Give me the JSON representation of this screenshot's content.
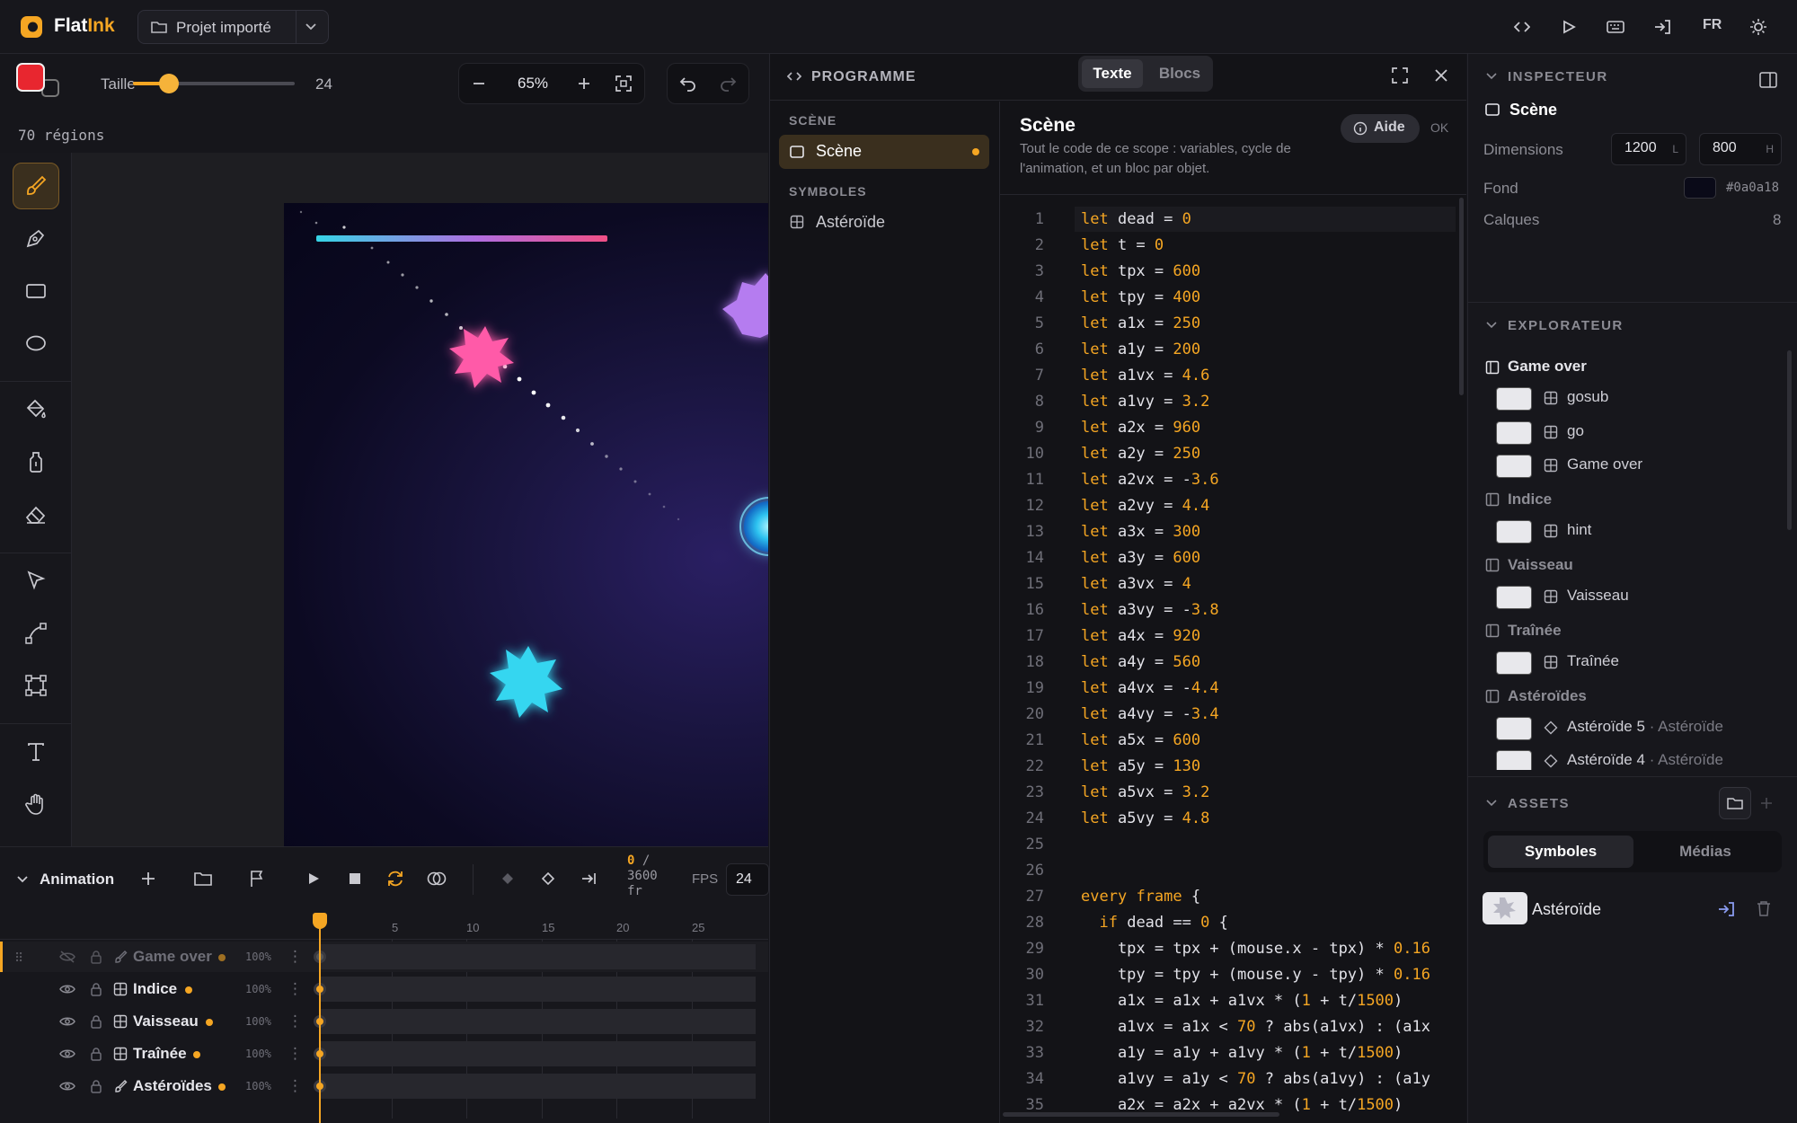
{
  "app": {
    "name_main": "Flat",
    "name_accent": "Ink",
    "project": "Projet importé",
    "language": "FR",
    "accent": "#f5a623"
  },
  "brush": {
    "size_label": "Taille",
    "size_value": "24",
    "color": "#e8262f",
    "size_fraction": 0.22
  },
  "view": {
    "zoom": "65%",
    "regions": "70 régions"
  },
  "tools": [
    "brush-icon",
    "pen-icon",
    "rectangle-icon",
    "ellipse-icon",
    "bucket-icon",
    "dropper-icon",
    "eraser-icon",
    "select-icon",
    "node-icon",
    "transform-icon",
    "text-icon",
    "hand-icon"
  ],
  "timeline": {
    "title": "Animation",
    "frame_current": "0",
    "frame_total": "/ 3600",
    "frame_unit": "fr",
    "fps_label": "FPS",
    "fps_value": "24",
    "ruler": [
      "5",
      "10",
      "15",
      "20",
      "25"
    ],
    "layers": [
      {
        "name": "Game over",
        "opacity": "100%",
        "type": "brush",
        "dim": true
      },
      {
        "name": "Indice",
        "opacity": "100%",
        "type": "symbol"
      },
      {
        "name": "Vaisseau",
        "opacity": "100%",
        "type": "symbol"
      },
      {
        "name": "Traînée",
        "opacity": "100%",
        "type": "symbol"
      },
      {
        "name": "Astéroïdes",
        "opacity": "100%",
        "type": "brush"
      }
    ]
  },
  "program": {
    "title": "PROGRAMME",
    "mode_text": "Texte",
    "mode_blocks": "Blocs",
    "section_scene": "SCÈNE",
    "scene_item": "Scène",
    "section_symbols": "SYMBOLES",
    "symbol_item": "Astéroïde",
    "scope_title": "Scène",
    "scope_desc": "Tout le code de ce scope : variables, cycle de l'animation, et un bloc par objet.",
    "help": "Aide",
    "ok": "OK",
    "code": [
      "let dead = 0",
      "let t = 0",
      "let tpx = 600",
      "let tpy = 400",
      "let a1x = 250",
      "let a1y = 200",
      "let a1vx = 4.6",
      "let a1vy = 3.2",
      "let a2x = 960",
      "let a2y = 250",
      "let a2vx = -3.6",
      "let a2vy = 4.4",
      "let a3x = 300",
      "let a3y = 600",
      "let a3vx = 4",
      "let a3vy = -3.8",
      "let a4x = 920",
      "let a4y = 560",
      "let a4vx = -4.4",
      "let a4vy = -3.4",
      "let a5x = 600",
      "let a5y = 130",
      "let a5vx = 3.2",
      "let a5vy = 4.8",
      "",
      "",
      "every frame {",
      "  if dead == 0 {",
      "    tpx = tpx + (mouse.x - tpx) * 0.16",
      "    tpy = tpy + (mouse.y - tpy) * 0.16",
      "    a1x = a1x + a1vx * (1 + t/1500)",
      "    a1vx = a1x < 70 ? abs(a1vx) : (a1x",
      "    a1y = a1y + a1vy * (1 + t/1500)",
      "    a1vy = a1y < 70 ? abs(a1vy) : (a1y",
      "    a2x = a2x + a2vx * (1 + t/1500)"
    ]
  },
  "inspector": {
    "title": "INSPECTEUR",
    "selection": "Scène",
    "dimensions_label": "Dimensions",
    "width": "1200",
    "width_unit": "L",
    "height": "800",
    "height_unit": "H",
    "bg_label": "Fond",
    "bg_value": "#0a0a18",
    "layers_label": "Calques",
    "layers_value": "8"
  },
  "explorer": {
    "title": "EXPLORATEUR",
    "groups": [
      {
        "name": "Game over",
        "items": [
          {
            "name": "gosub",
            "kind": "symbol"
          },
          {
            "name": "go",
            "kind": "symbol"
          },
          {
            "name": "Game over",
            "kind": "symbol"
          }
        ]
      },
      {
        "name": "Indice",
        "items": [
          {
            "name": "hint",
            "kind": "symbol"
          }
        ]
      },
      {
        "name": "Vaisseau",
        "items": [
          {
            "name": "Vaisseau",
            "kind": "symbol"
          }
        ]
      },
      {
        "name": "Traînée",
        "items": [
          {
            "name": "Traînée",
            "kind": "symbol"
          }
        ]
      },
      {
        "name": "Astéroïdes",
        "items": [
          {
            "name": "Astéroïde 5",
            "sub": "· Astéroïde",
            "kind": "instance"
          },
          {
            "name": "Astéroïde 4",
            "sub": "· Astéroïde",
            "kind": "instance"
          }
        ]
      }
    ]
  },
  "assets": {
    "title": "ASSETS",
    "tab_symbols": "Symboles",
    "tab_media": "Médias",
    "items": [
      {
        "name": "Astéroïde"
      }
    ]
  }
}
